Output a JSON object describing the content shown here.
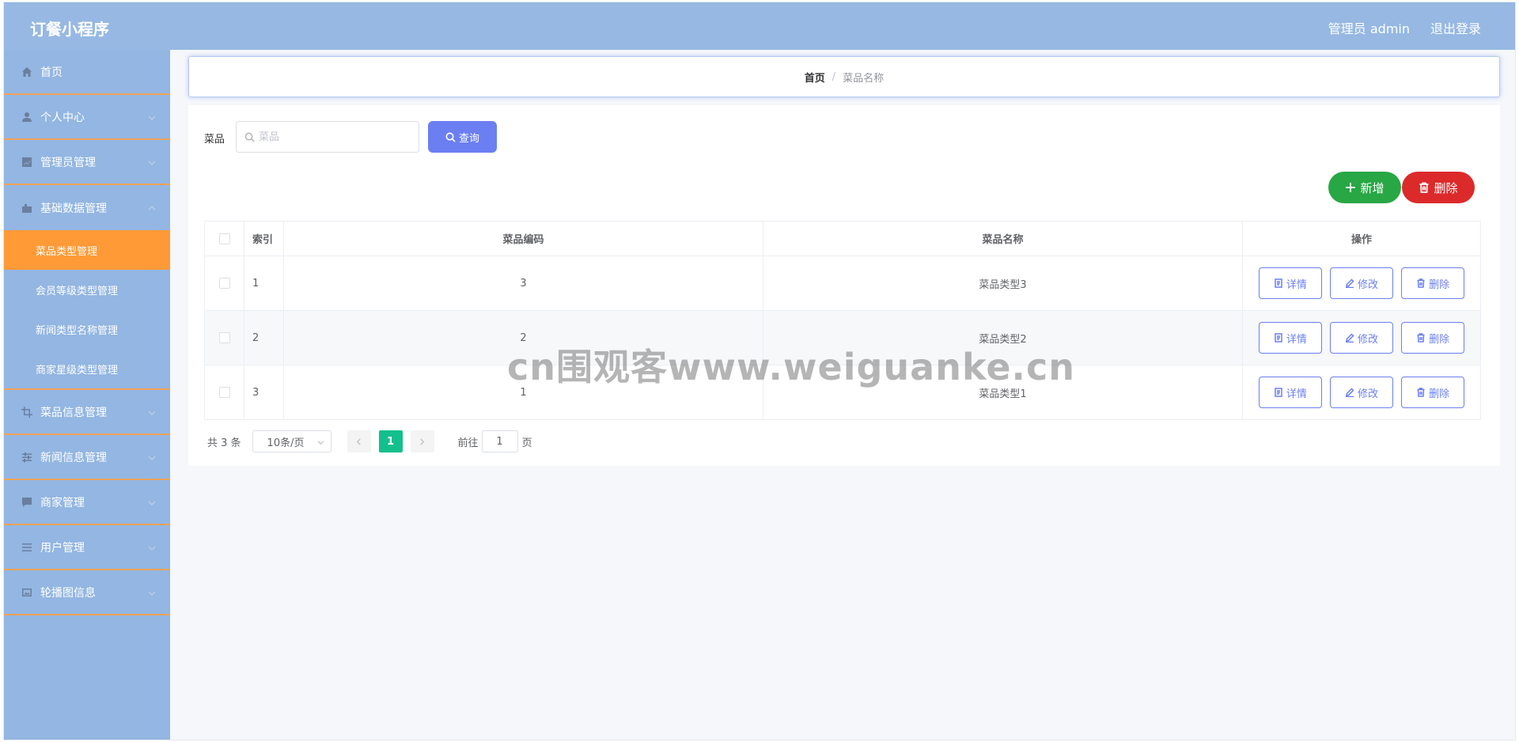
{
  "header": {
    "app_title": "订餐小程序",
    "user_label": "管理员 admin",
    "logout_label": "退出登录"
  },
  "sidebar": {
    "items": [
      {
        "label": "首页",
        "icon": "home-icon"
      },
      {
        "label": "个人中心",
        "icon": "user-icon"
      },
      {
        "label": "管理员管理",
        "icon": "chart-icon"
      },
      {
        "label": "基础数据管理",
        "icon": "briefcase-icon"
      },
      {
        "label": "菜品信息管理",
        "icon": "crop-icon"
      },
      {
        "label": "新闻信息管理",
        "icon": "sliders-icon"
      },
      {
        "label": "商家管理",
        "icon": "chat-icon"
      },
      {
        "label": "用户管理",
        "icon": "list-icon"
      },
      {
        "label": "轮播图信息",
        "icon": "image-icon"
      }
    ],
    "sub_items": [
      {
        "label": "菜品类型管理",
        "active": true
      },
      {
        "label": "会员等级类型管理",
        "active": false
      },
      {
        "label": "新闻类型名称管理",
        "active": false
      },
      {
        "label": "商家星级类型管理",
        "active": false
      }
    ],
    "accent_color": "#ff9a36"
  },
  "breadcrumb": {
    "home": "首页",
    "separator": "/",
    "current": "菜品名称"
  },
  "search": {
    "label": "菜品",
    "placeholder": "菜品",
    "query_label": "查询"
  },
  "toolbar": {
    "add_label": "新增",
    "delete_label": "删除"
  },
  "table": {
    "headers": [
      "索引",
      "菜品编码",
      "菜品名称",
      "操作"
    ],
    "rows": [
      {
        "index": "1",
        "code": "3",
        "name": "菜品类型3"
      },
      {
        "index": "2",
        "code": "2",
        "name": "菜品类型2"
      },
      {
        "index": "3",
        "code": "1",
        "name": "菜品类型1"
      }
    ],
    "actions": {
      "detail": "详情",
      "edit": "修改",
      "delete": "删除"
    }
  },
  "pagination": {
    "total_text": "共 3 条",
    "page_size": "10条/页",
    "current_page": "1",
    "goto_label": "前往",
    "goto_value": "1",
    "page_suffix": "页"
  },
  "watermark": "cn围观客www.weiguanke.cn"
}
